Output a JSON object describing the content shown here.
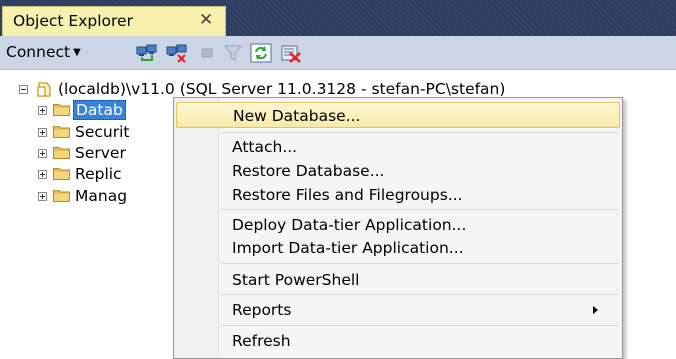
{
  "panel": {
    "title": "Object Explorer",
    "close_glyph": "✕"
  },
  "toolbar": {
    "connect_label": "Connect",
    "connect_caret": "▼",
    "icons": [
      "connect-object-explorer-icon",
      "disconnect-icon",
      "stop-icon",
      "filter-icon",
      "refresh-icon",
      "object-explorer-details-icon"
    ]
  },
  "tree": {
    "server_label": "(localdb)\\v11.0 (SQL Server 11.0.3128 - stefan-PC\\stefan)",
    "nodes": [
      {
        "label": "Datab",
        "selected": true
      },
      {
        "label": "Securit"
      },
      {
        "label": "Server"
      },
      {
        "label": "Replic"
      },
      {
        "label": "Manag"
      }
    ]
  },
  "context_menu": {
    "items": [
      {
        "label": "New Database...",
        "highlight": true
      },
      {
        "label": "Attach..."
      },
      {
        "label": "Restore Database..."
      },
      {
        "label": "Restore Files and Filegroups..."
      },
      {
        "label": "Deploy Data-tier Application..."
      },
      {
        "label": "Import Data-tier Application..."
      },
      {
        "label": "Start PowerShell"
      },
      {
        "label": "Reports",
        "submenu": true
      },
      {
        "label": "Refresh"
      }
    ]
  },
  "colors": {
    "tab_active": "#f8f1ad",
    "tab_strip": "#2b3c5e",
    "toolbar": "#ccd5e5",
    "selection": "#3a82d6",
    "menu_highlight": "#f9e9a8"
  }
}
